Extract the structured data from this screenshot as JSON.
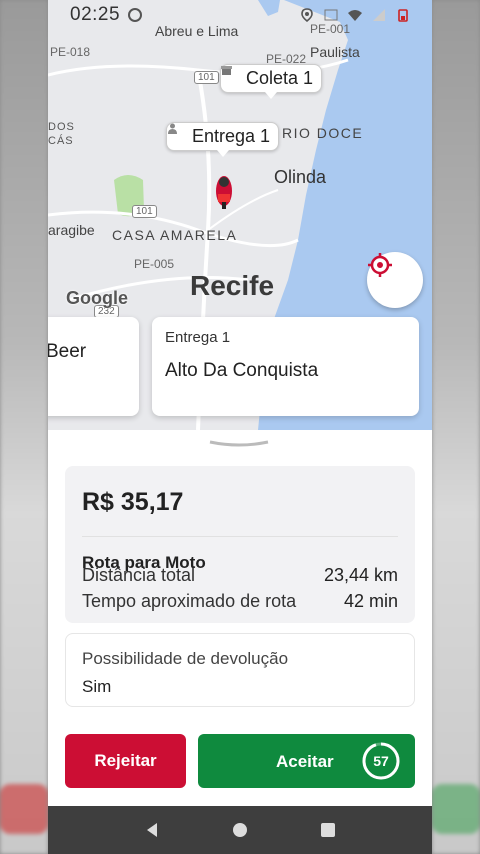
{
  "status_bar": {
    "time": "02:25",
    "icons": [
      "sync-icon",
      "location-icon",
      "volte-icon",
      "wifi-icon",
      "signal-icon",
      "battery-icon"
    ]
  },
  "map": {
    "labels": {
      "abreu": "Abreu e Lima",
      "paulista": "Paulista",
      "rio_doce": "RIO DOCE",
      "olinda": "Olinda",
      "casa_amarela": "CASA AMARELA",
      "recife": "Recife",
      "ragibe": "aragibe",
      "dos": "DOS",
      "cas": "CÁS"
    },
    "roads": {
      "pe018": "PE-018",
      "pe022": "PE-022",
      "pe001": "PE-001",
      "pe005": "PE-005",
      "br101a": "101",
      "br101b": "101",
      "r232": "232"
    },
    "watermark": "Google",
    "pins": {
      "coleta": "Coleta 1",
      "entrega": "Entrega 1"
    }
  },
  "cards": {
    "left": {
      "name": "Beer"
    },
    "right": {
      "title": "Entrega 1",
      "name": "Alto Da Conquista"
    }
  },
  "offer": {
    "price": "R$ 35,17",
    "route_title": "Rota para Moto",
    "distance_label": "Distância total",
    "distance_value": "23,44 km",
    "time_label": "Tempo aproximado de rota",
    "time_value": "42 min",
    "return_label": "Possibilidade de devolução",
    "return_value": "Sim"
  },
  "actions": {
    "reject": "Rejeitar",
    "accept": "Aceitar",
    "countdown": "57",
    "countdown_fraction": 0.95
  },
  "colors": {
    "reject": "#cc0e34",
    "accept": "#0f8a3e",
    "brand_red": "#cc0e34",
    "sea": "#aac9f0"
  }
}
